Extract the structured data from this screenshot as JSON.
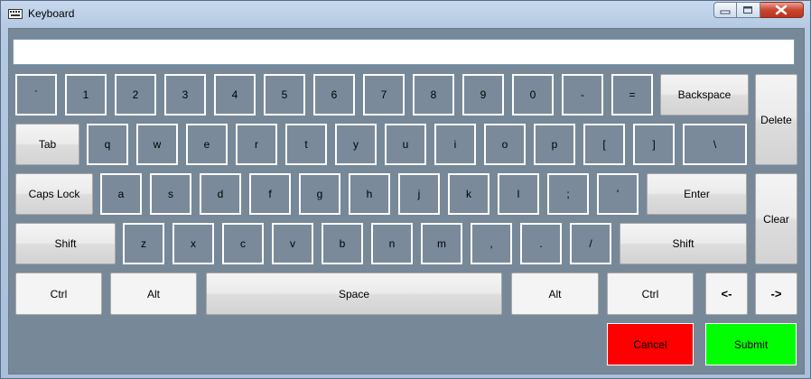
{
  "window": {
    "title": "Keyboard",
    "icon": "keyboard-icon",
    "controls": [
      "minimize-icon",
      "maximize-icon",
      "close-icon"
    ]
  },
  "input": {
    "value": "",
    "placeholder": ""
  },
  "keys": {
    "row1": [
      "`",
      "1",
      "2",
      "3",
      "4",
      "5",
      "6",
      "7",
      "8",
      "9",
      "0",
      "-",
      "="
    ],
    "backspace": "Backspace",
    "tab": "Tab",
    "row2": [
      "q",
      "w",
      "e",
      "r",
      "t",
      "y",
      "u",
      "i",
      "o",
      "p",
      "[",
      "]",
      "\\"
    ],
    "delete": "Delete",
    "caps": "Caps Lock",
    "row3": [
      "a",
      "s",
      "d",
      "f",
      "g",
      "h",
      "j",
      "k",
      "l",
      ";",
      "'"
    ],
    "enter": "Enter",
    "clear": "Clear",
    "shift_left": "Shift",
    "row4": [
      "z",
      "x",
      "c",
      "v",
      "b",
      "n",
      "m",
      ",",
      ".",
      "/"
    ],
    "shift_right": "Shift",
    "ctrl_left": "Ctrl",
    "alt_left": "Alt",
    "space": "Space",
    "alt_right": "Alt",
    "ctrl_right": "Ctrl",
    "arrow_left": "<-",
    "arrow_right": "->",
    "cancel": "Cancel",
    "submit": "Submit"
  },
  "colors": {
    "client_bg": "#778899",
    "cancel": "#ff0000",
    "submit": "#00ff00"
  }
}
